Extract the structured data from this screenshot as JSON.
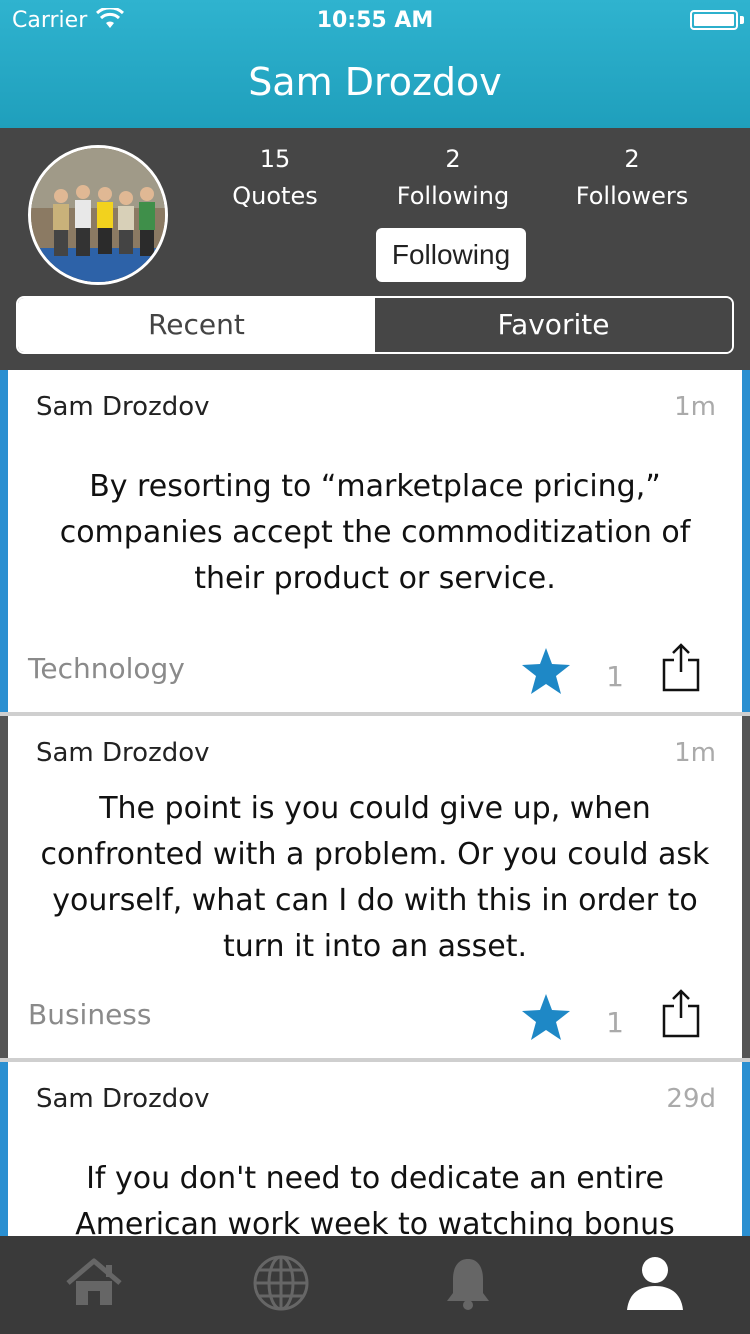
{
  "status": {
    "carrier": "Carrier",
    "time": "10:55 AM"
  },
  "header": {
    "title": "Sam Drozdov"
  },
  "profile": {
    "stats": [
      {
        "value": "15",
        "label": "Quotes"
      },
      {
        "value": "2",
        "label": "Following"
      },
      {
        "value": "2",
        "label": "Followers"
      }
    ],
    "follow_button": "Following",
    "segments": {
      "recent": "Recent",
      "favorite": "Favorite",
      "selected": "Recent"
    }
  },
  "quotes": [
    {
      "author": "Sam Drozdov",
      "ago": "1m",
      "lines": [
        "By resorting to “marketplace pricing,”",
        "companies accept the commoditization of",
        "their product or service."
      ],
      "category": "Technology",
      "favorites": "1"
    },
    {
      "author": "Sam Drozdov",
      "ago": "1m",
      "lines": [
        "The point is you could give up, when",
        "confronted with a problem. Or you could ask",
        "yourself, what can I do with this in order to",
        "turn it into an asset."
      ],
      "category": "Business",
      "favorites": "1"
    },
    {
      "author": "Sam Drozdov",
      "ago": "29d",
      "lines": [
        "If you don't need to dedicate an entire",
        "American work week to watching bonus"
      ]
    }
  ],
  "tabs": [
    {
      "icon": "home-icon",
      "active": false
    },
    {
      "icon": "globe-icon",
      "active": false
    },
    {
      "icon": "bell-icon",
      "active": false
    },
    {
      "icon": "profile-icon",
      "active": true
    }
  ],
  "colors": {
    "accent": "#1f9fbc",
    "star": "#1e88c6",
    "card_edge_blue": "#2a8fd1",
    "card_edge_gray": "#555555"
  }
}
